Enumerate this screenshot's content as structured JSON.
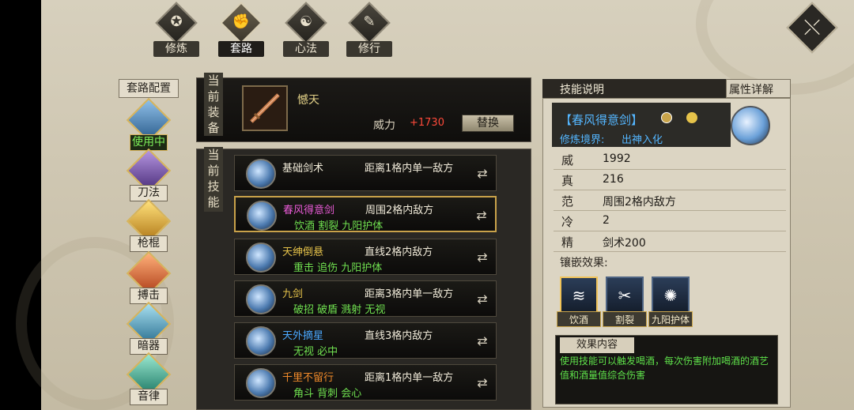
{
  "top_tabs": [
    {
      "label": "修炼",
      "glyph": "✪"
    },
    {
      "label": "套路",
      "glyph": "✊"
    },
    {
      "label": "心法",
      "glyph": "☯"
    },
    {
      "label": "修行",
      "glyph": "✎"
    }
  ],
  "active_top_tab": "套路",
  "close_label": "⤬",
  "categories": {
    "title": "套路配置",
    "items": [
      {
        "label": "使用中",
        "color": "#3a6fa6",
        "active": true
      },
      {
        "label": "刀法",
        "color": "#6c4a9c"
      },
      {
        "label": "枪棍",
        "color": "#d8a22a"
      },
      {
        "label": "搏击",
        "color": "#d45a2a"
      },
      {
        "label": "暗器",
        "color": "#4a8fb0"
      },
      {
        "label": "音律",
        "color": "#3aa08a"
      }
    ]
  },
  "equipment": {
    "section_label": "当前装备",
    "name": "憾天",
    "power_label": "威力",
    "power_value": "+1730",
    "replace_label": "替换"
  },
  "skills_section_label": "当前技能",
  "skills": [
    {
      "name": "基础剑术",
      "name_color": "#f2ecd9",
      "range": "距离1格内单一敌方",
      "effects": ""
    },
    {
      "name": "春风得意剑",
      "name_color": "#e85ad6",
      "range": "周围2格内敌方",
      "effects": "饮酒 割裂 九阳护体",
      "selected": true
    },
    {
      "name": "天绅倒悬",
      "name_color": "#e6c34a",
      "range": "直线2格内敌方",
      "effects": "重击 追伤 九阳护体"
    },
    {
      "name": "九剑",
      "name_color": "#e6c34a",
      "range": "距离3格内单一敌方",
      "effects": "破招 破盾 溅射 无视"
    },
    {
      "name": "天外摘星",
      "name_color": "#4aa8ff",
      "range": "直线3格内敌方",
      "effects": "无视 必中"
    },
    {
      "name": "千里不留行",
      "name_color": "#f08a2a",
      "range": "距离1格内单一敌方",
      "effects": "角斗 背刺 会心"
    }
  ],
  "skill_info": {
    "title": "技能说明",
    "attr_detail_label": "属性详解",
    "skill_title": "【春风得意剑】",
    "cultivation_label": "修炼境界:",
    "cultivation_value": "出神入化",
    "stats": [
      {
        "key": "威",
        "value": "1992"
      },
      {
        "key": "真",
        "value": "216"
      },
      {
        "key": "范",
        "value": "周围2格内敌方"
      },
      {
        "key": "冷",
        "value": "2"
      },
      {
        "key": "精",
        "value": "剑术200"
      }
    ],
    "inlay_label": "镶嵌效果:",
    "inlays": [
      {
        "label": "饮酒",
        "icon": "≋"
      },
      {
        "label": "割裂",
        "icon": "✂"
      },
      {
        "label": "九阳护体",
        "icon": "✺"
      }
    ],
    "effect_title": "效果内容",
    "effect_text": "使用技能可以触发喝酒，每次伤害附加喝酒的酒艺值和酒量值综合伤害"
  }
}
